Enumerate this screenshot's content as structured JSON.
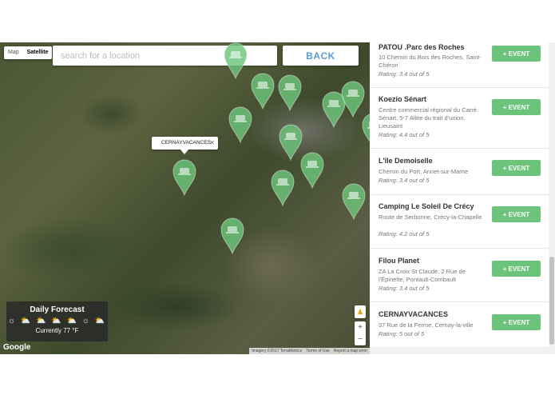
{
  "map": {
    "maptype": {
      "map": "Map",
      "satellite": "Satellite"
    },
    "search_placeholder": "search for a location",
    "back_label": "BACK",
    "infowindow": {
      "label": "CERNAYVACANCES",
      "close": "✕"
    },
    "pin_color": "#6cc47a",
    "forecast": {
      "title": "Daily Forecast",
      "icons": "☼ ⛅ ⛅ ⛅ ⛅ ☼ ⛅",
      "current": "Currently 77 °F"
    },
    "google_logo": "Google",
    "attribution": {
      "imagery": "Imagery ©2017 TerraMetrics",
      "terms": "Terms of Use",
      "report": "Report a map error"
    },
    "pegman": "♟",
    "zoom_in": "+",
    "zoom_out": "−"
  },
  "list": {
    "event_label": "+ EVENT",
    "accent": "#6cc47a",
    "items": [
      {
        "name": "PATOU .Parc des Roches",
        "address": "10 Chemin du Bois des Roches, Saint-Chéron",
        "rating": "Rating: 3.4 out of 5"
      },
      {
        "name": "Koezio Sénart",
        "address": "Centre commercial régional du Carré Sénart, 5-7 Allée du trait d'union, Lieusaint",
        "rating": "Rating: 4.4 out of 5"
      },
      {
        "name": "L'île Demoiselle",
        "address": "Chemin du Port, Annet-sur-Marne",
        "rating": "Rating: 3.4 out of 5"
      },
      {
        "name": "Camping Le Soleil De Crécy",
        "address": "Route de Serbonne, Crécy-la-Chapelle",
        "rating": "Rating: 4.2 out of 5"
      },
      {
        "name": "Filou Planet",
        "address": "ZA La Croix St Claude, 2 Rue de l'Épinette, Pontault-Combault",
        "rating": "Rating: 3.4 out of 5"
      },
      {
        "name": "CERNAYVACANCES",
        "address": "37 Rue de la Ferme, Cernay-la-ville",
        "rating": "Rating: 5 out of 5"
      }
    ]
  }
}
